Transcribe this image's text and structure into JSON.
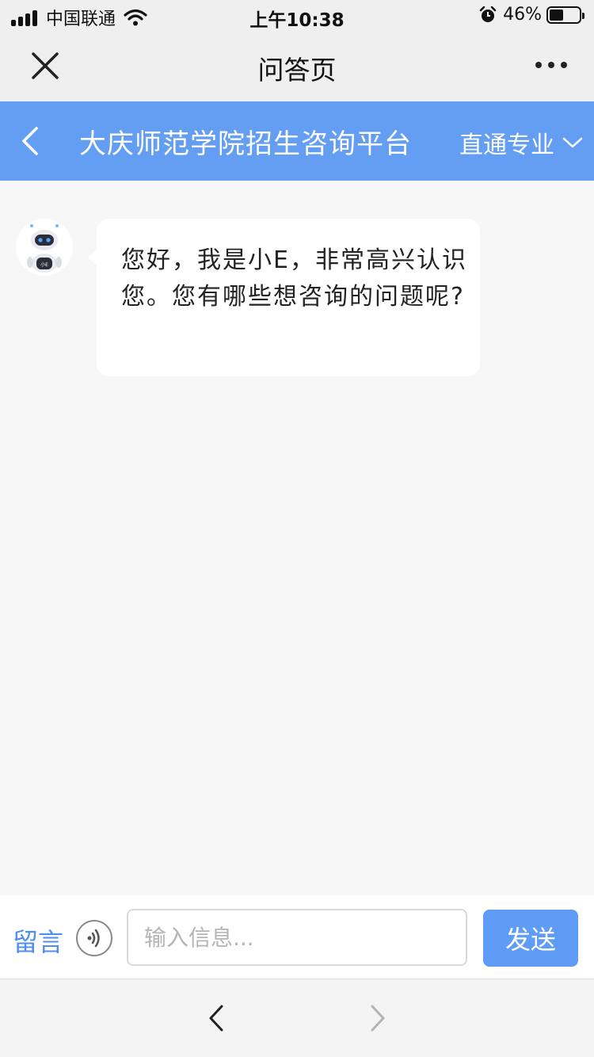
{
  "status_bar": {
    "carrier": "中国联通",
    "time": "上午10:38",
    "battery": "46%",
    "battery_level": 0.46
  },
  "nav": {
    "title": "问答页"
  },
  "header": {
    "title": "大庆师范学院招生咨询平台",
    "dropdown_label": "直通专业",
    "background_color": "#639ef3"
  },
  "chat": {
    "messages": [
      {
        "sender": "bot",
        "avatar_icon": "robot-icon",
        "text": "您好，我是小E，非常高兴认识您。您有哪些想咨询的问题呢?"
      }
    ]
  },
  "input_bar": {
    "leave_message_label": "留言",
    "input_value": "",
    "input_placeholder": "输入信息...",
    "send_label": "发送"
  },
  "colors": {
    "accent": "#5f9cf5",
    "link": "#4d8ef0"
  }
}
